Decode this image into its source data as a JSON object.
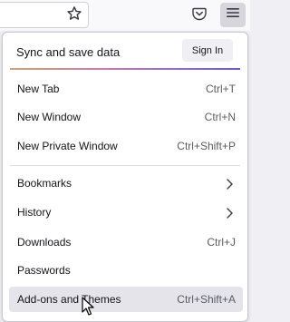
{
  "toolbar": {
    "star_icon": "star-icon",
    "pocket_icon": "pocket-icon",
    "menu_icon": "hamburger-menu-icon"
  },
  "menu": {
    "sync_label": "Sync and save data",
    "signin_label": "Sign In",
    "items": [
      {
        "label": "New Tab",
        "shortcut": "Ctrl+T"
      },
      {
        "label": "New Window",
        "shortcut": "Ctrl+N"
      },
      {
        "label": "New Private Window",
        "shortcut": "Ctrl+Shift+P"
      },
      {
        "label": "Bookmarks",
        "submenu_icon": "chevron-right-icon"
      },
      {
        "label": "History",
        "submenu_icon": "chevron-right-icon"
      },
      {
        "label": "Downloads",
        "shortcut": "Ctrl+J"
      },
      {
        "label": "Passwords"
      },
      {
        "label": "Add-ons and Themes",
        "shortcut": "Ctrl+Shift+A",
        "hovered": true
      }
    ]
  },
  "colors": {
    "hover_bg": "#e4e4ea",
    "menu_button_active": "#d6d6dc"
  }
}
